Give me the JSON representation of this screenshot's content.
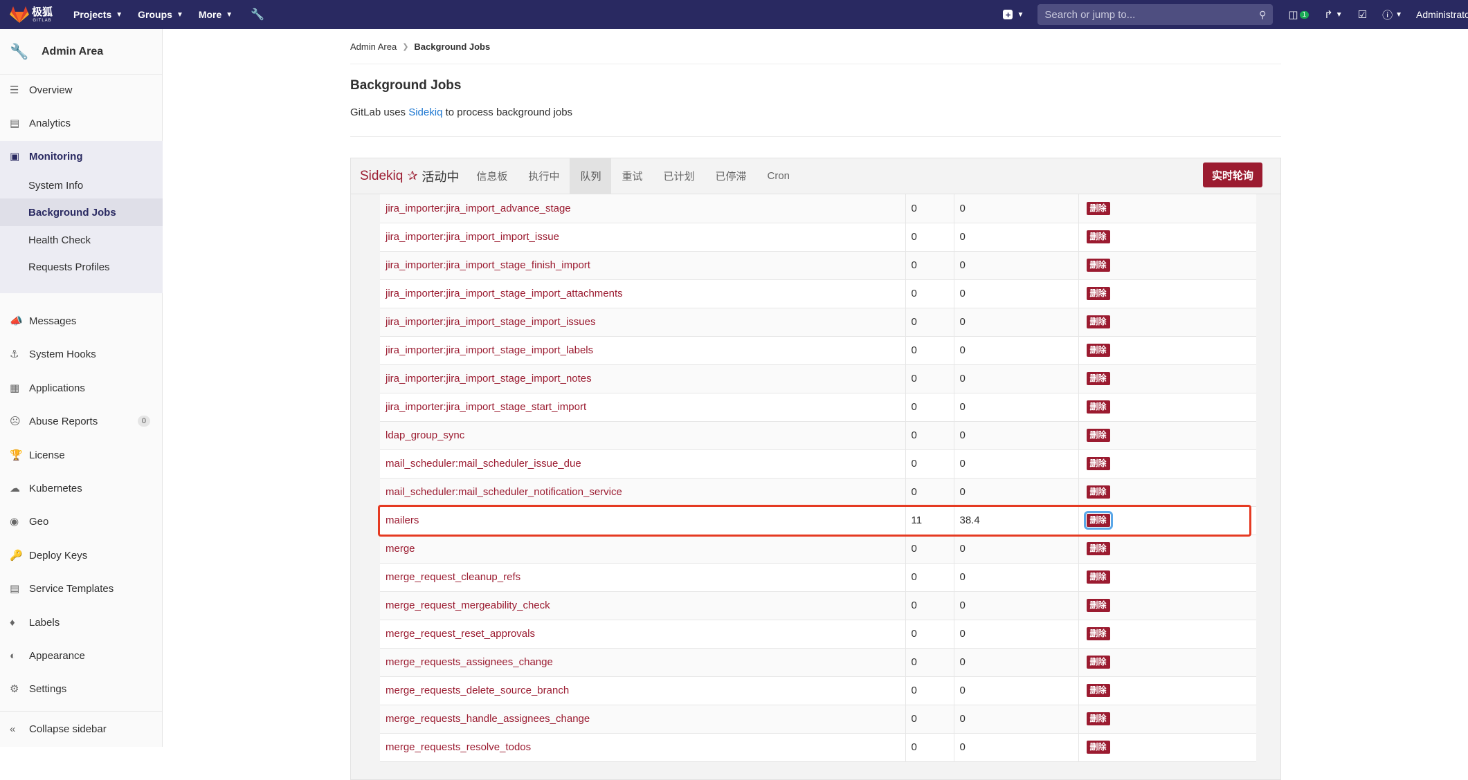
{
  "topnav": {
    "brand_cn": "极狐",
    "brand_en": "GITLAB",
    "menus": [
      "Projects",
      "Groups",
      "More"
    ],
    "search_placeholder": "Search or jump to...",
    "issues_badge": "1",
    "user": "Administrator",
    "brand_color": "#292961"
  },
  "sidebar": {
    "title": "Admin Area",
    "items": [
      {
        "label": "Overview",
        "icon": "overview-icon"
      },
      {
        "label": "Analytics",
        "icon": "analytics-icon"
      },
      {
        "label": "Monitoring",
        "icon": "monitor-icon"
      },
      {
        "label": "Messages",
        "icon": "bullhorn-icon"
      },
      {
        "label": "System Hooks",
        "icon": "hook-icon"
      },
      {
        "label": "Applications",
        "icon": "applications-icon"
      },
      {
        "label": "Abuse Reports",
        "icon": "abuse-icon",
        "count": "0"
      },
      {
        "label": "License",
        "icon": "license-icon"
      },
      {
        "label": "Kubernetes",
        "icon": "cloud-icon"
      },
      {
        "label": "Geo",
        "icon": "location-icon"
      },
      {
        "label": "Deploy Keys",
        "icon": "key-icon"
      },
      {
        "label": "Service Templates",
        "icon": "template-icon"
      },
      {
        "label": "Labels",
        "icon": "label-icon"
      },
      {
        "label": "Appearance",
        "icon": "appearance-icon"
      },
      {
        "label": "Settings",
        "icon": "settings-icon"
      }
    ],
    "monitoring_sub": [
      "System Info",
      "Background Jobs",
      "Health Check",
      "Requests Profiles"
    ],
    "collapse": "Collapse sidebar"
  },
  "breadcrumb": {
    "root": "Admin Area",
    "current": "Background Jobs"
  },
  "page": {
    "title": "Background Jobs",
    "desc_before": "GitLab uses",
    "desc_link": "Sidekiq",
    "desc_after": "to process background jobs"
  },
  "sidekiq": {
    "brand": "Sidekiq",
    "status": "活动中",
    "tabs": [
      "信息板",
      "执行中",
      "队列",
      "重试",
      "已计划",
      "已停滞",
      "Cron"
    ],
    "active_tab": "队列",
    "poll_button": "实时轮询",
    "accent": "#9b1b30",
    "delete_label": "删除",
    "queues": [
      {
        "name": "jira_importer:jira_import_advance_stage",
        "size": "0",
        "latency": "0"
      },
      {
        "name": "jira_importer:jira_import_import_issue",
        "size": "0",
        "latency": "0"
      },
      {
        "name": "jira_importer:jira_import_stage_finish_import",
        "size": "0",
        "latency": "0"
      },
      {
        "name": "jira_importer:jira_import_stage_import_attachments",
        "size": "0",
        "latency": "0"
      },
      {
        "name": "jira_importer:jira_import_stage_import_issues",
        "size": "0",
        "latency": "0"
      },
      {
        "name": "jira_importer:jira_import_stage_import_labels",
        "size": "0",
        "latency": "0"
      },
      {
        "name": "jira_importer:jira_import_stage_import_notes",
        "size": "0",
        "latency": "0"
      },
      {
        "name": "jira_importer:jira_import_stage_start_import",
        "size": "0",
        "latency": "0"
      },
      {
        "name": "ldap_group_sync",
        "size": "0",
        "latency": "0"
      },
      {
        "name": "mail_scheduler:mail_scheduler_issue_due",
        "size": "0",
        "latency": "0"
      },
      {
        "name": "mail_scheduler:mail_scheduler_notification_service",
        "size": "0",
        "latency": "0"
      },
      {
        "name": "mailers",
        "size": "11",
        "latency": "38.4"
      },
      {
        "name": "merge",
        "size": "0",
        "latency": "0"
      },
      {
        "name": "merge_request_cleanup_refs",
        "size": "0",
        "latency": "0"
      },
      {
        "name": "merge_request_mergeability_check",
        "size": "0",
        "latency": "0"
      },
      {
        "name": "merge_request_reset_approvals",
        "size": "0",
        "latency": "0"
      },
      {
        "name": "merge_requests_assignees_change",
        "size": "0",
        "latency": "0"
      },
      {
        "name": "merge_requests_delete_source_branch",
        "size": "0",
        "latency": "0"
      },
      {
        "name": "merge_requests_handle_assignees_change",
        "size": "0",
        "latency": "0"
      },
      {
        "name": "merge_requests_resolve_todos",
        "size": "0",
        "latency": "0"
      }
    ]
  }
}
